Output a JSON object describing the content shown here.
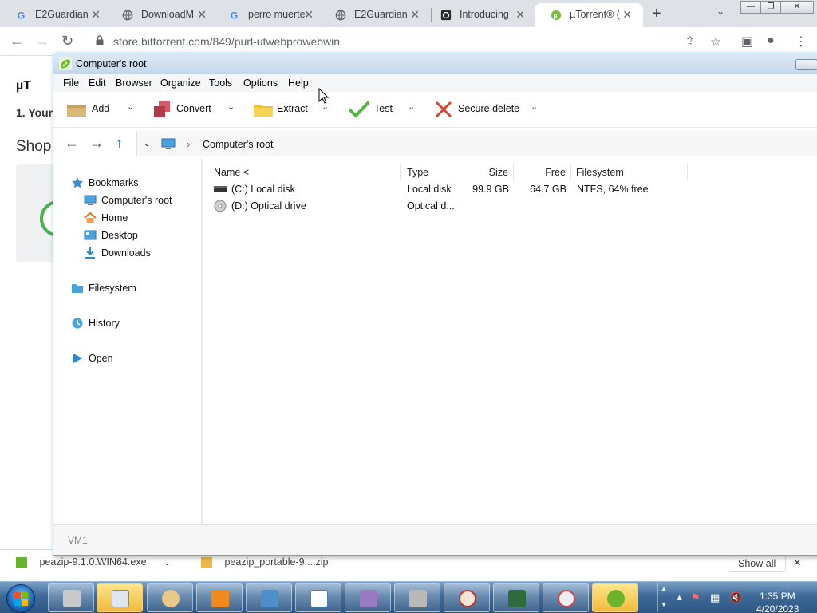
{
  "browser": {
    "tabs": [
      {
        "title": "E2Guardian",
        "icon": "google-g-icon"
      },
      {
        "title": "DownloadM",
        "icon": "globe-icon"
      },
      {
        "title": "perro muerte",
        "icon": "google-g-icon"
      },
      {
        "title": "E2Guardian",
        "icon": "globe-icon"
      },
      {
        "title": "Introducing",
        "icon": "openai-icon"
      },
      {
        "title": "µTorrent® (",
        "icon": "utorrent-icon",
        "active": true
      }
    ],
    "url": "store.bittorrent.com/849/purl-utwebprowebwin",
    "page": {
      "logo_text": "µT",
      "step_text": "1. Your",
      "shop_text": "Shop"
    },
    "downloads": [
      {
        "name": "peazip-9.1.0.WIN64.exe"
      },
      {
        "name": "peazip_portable-9....zip"
      }
    ],
    "downloads_show_all": "Show all"
  },
  "peazip": {
    "title": "Computer's root",
    "menu": [
      "File",
      "Edit",
      "Browser",
      "Organize",
      "Tools",
      "Options",
      "Help"
    ],
    "tools": [
      {
        "label": "Add",
        "icon": "box-icon"
      },
      {
        "label": "Convert",
        "icon": "convert-icon"
      },
      {
        "label": "Extract",
        "icon": "folder-icon"
      },
      {
        "label": "Test",
        "icon": "checkmark-icon"
      },
      {
        "label": "Secure delete",
        "icon": "red-x-icon"
      }
    ],
    "address": {
      "crumb": "Computer's root"
    },
    "sidebar": {
      "bookmarks": "Bookmarks",
      "items": [
        "Computer's root",
        "Home",
        "Desktop",
        "Downloads"
      ],
      "filesystem": "Filesystem",
      "history": "History",
      "open": "Open"
    },
    "columns": [
      "Name <",
      "Type",
      "Size",
      "Free",
      "Filesystem"
    ],
    "rows": [
      {
        "name": "(C:) Local disk",
        "type": "Local disk",
        "size": "99.9 GB",
        "free": "64.7 GB",
        "fs": "NTFS, 64% free",
        "icon": "disk-drive-icon"
      },
      {
        "name": "(D:) Optical drive",
        "type": "Optical d...",
        "size": "",
        "free": "",
        "fs": "",
        "icon": "optical-drive-icon"
      }
    ],
    "status": "VM1"
  },
  "taskbar": {
    "time": "1:35 PM",
    "date": "4/20/2023",
    "pinned": [
      "scanner-icon",
      "calculator-icon",
      "paint-icon",
      "media-player-icon",
      "photo-viewer-icon",
      "wordpad-icon",
      "archive-icon",
      "server-lock-icon",
      "clock-icon",
      "monitor-icon",
      "speedometer-icon",
      "peazip-icon"
    ]
  },
  "colors": {
    "accent": "#3f6a98",
    "peazip_green": "#6ab42b",
    "title_bar": "#c5d7eb"
  }
}
